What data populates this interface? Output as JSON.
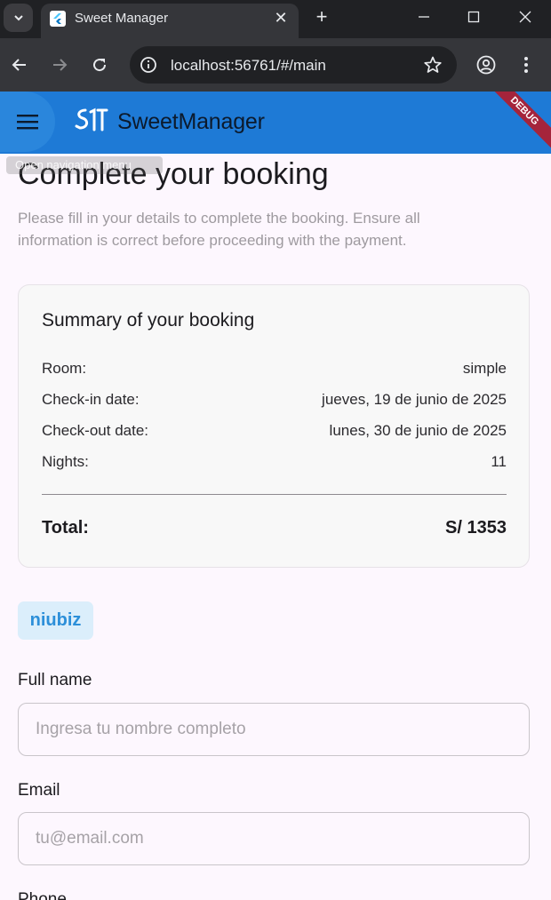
{
  "browser": {
    "tab_title": "Sweet Manager",
    "url": "localhost:56761/#/main",
    "icons": [
      "chevron-down-icon",
      "flutter-favicon-icon",
      "close-icon",
      "plus-icon",
      "minimize-icon",
      "maximize-icon",
      "window-close-icon",
      "back-icon",
      "forward-icon",
      "reload-icon",
      "info-icon",
      "star-icon",
      "profile-icon",
      "more-icon"
    ]
  },
  "appbar": {
    "title": "SweetManager",
    "debug_label": "DEBUG",
    "tooltip": "Open navigation menu",
    "color": "#1e7ad6"
  },
  "page": {
    "title": "Complete your booking",
    "description": "Please fill in your details to complete the booking. Ensure all information is correct before proceeding with the payment."
  },
  "summary": {
    "title": "Summary of your booking",
    "rows": [
      {
        "label": "Room:",
        "value": "simple"
      },
      {
        "label": "Check-in date:",
        "value": "jueves, 19 de junio de 2025"
      },
      {
        "label": "Check-out date:",
        "value": "lunes, 30 de junio de 2025"
      },
      {
        "label": "Nights:",
        "value": "11"
      }
    ],
    "total_label": "Total:",
    "total_value": "S/ 1353"
  },
  "payment": {
    "provider_label": "niubiz"
  },
  "form": {
    "full_name": {
      "label": "Full name",
      "placeholder": "Ingresa tu nombre completo",
      "value": ""
    },
    "email": {
      "label": "Email",
      "placeholder": "tu@email.com",
      "value": ""
    },
    "phone": {
      "label": "Phone"
    }
  }
}
